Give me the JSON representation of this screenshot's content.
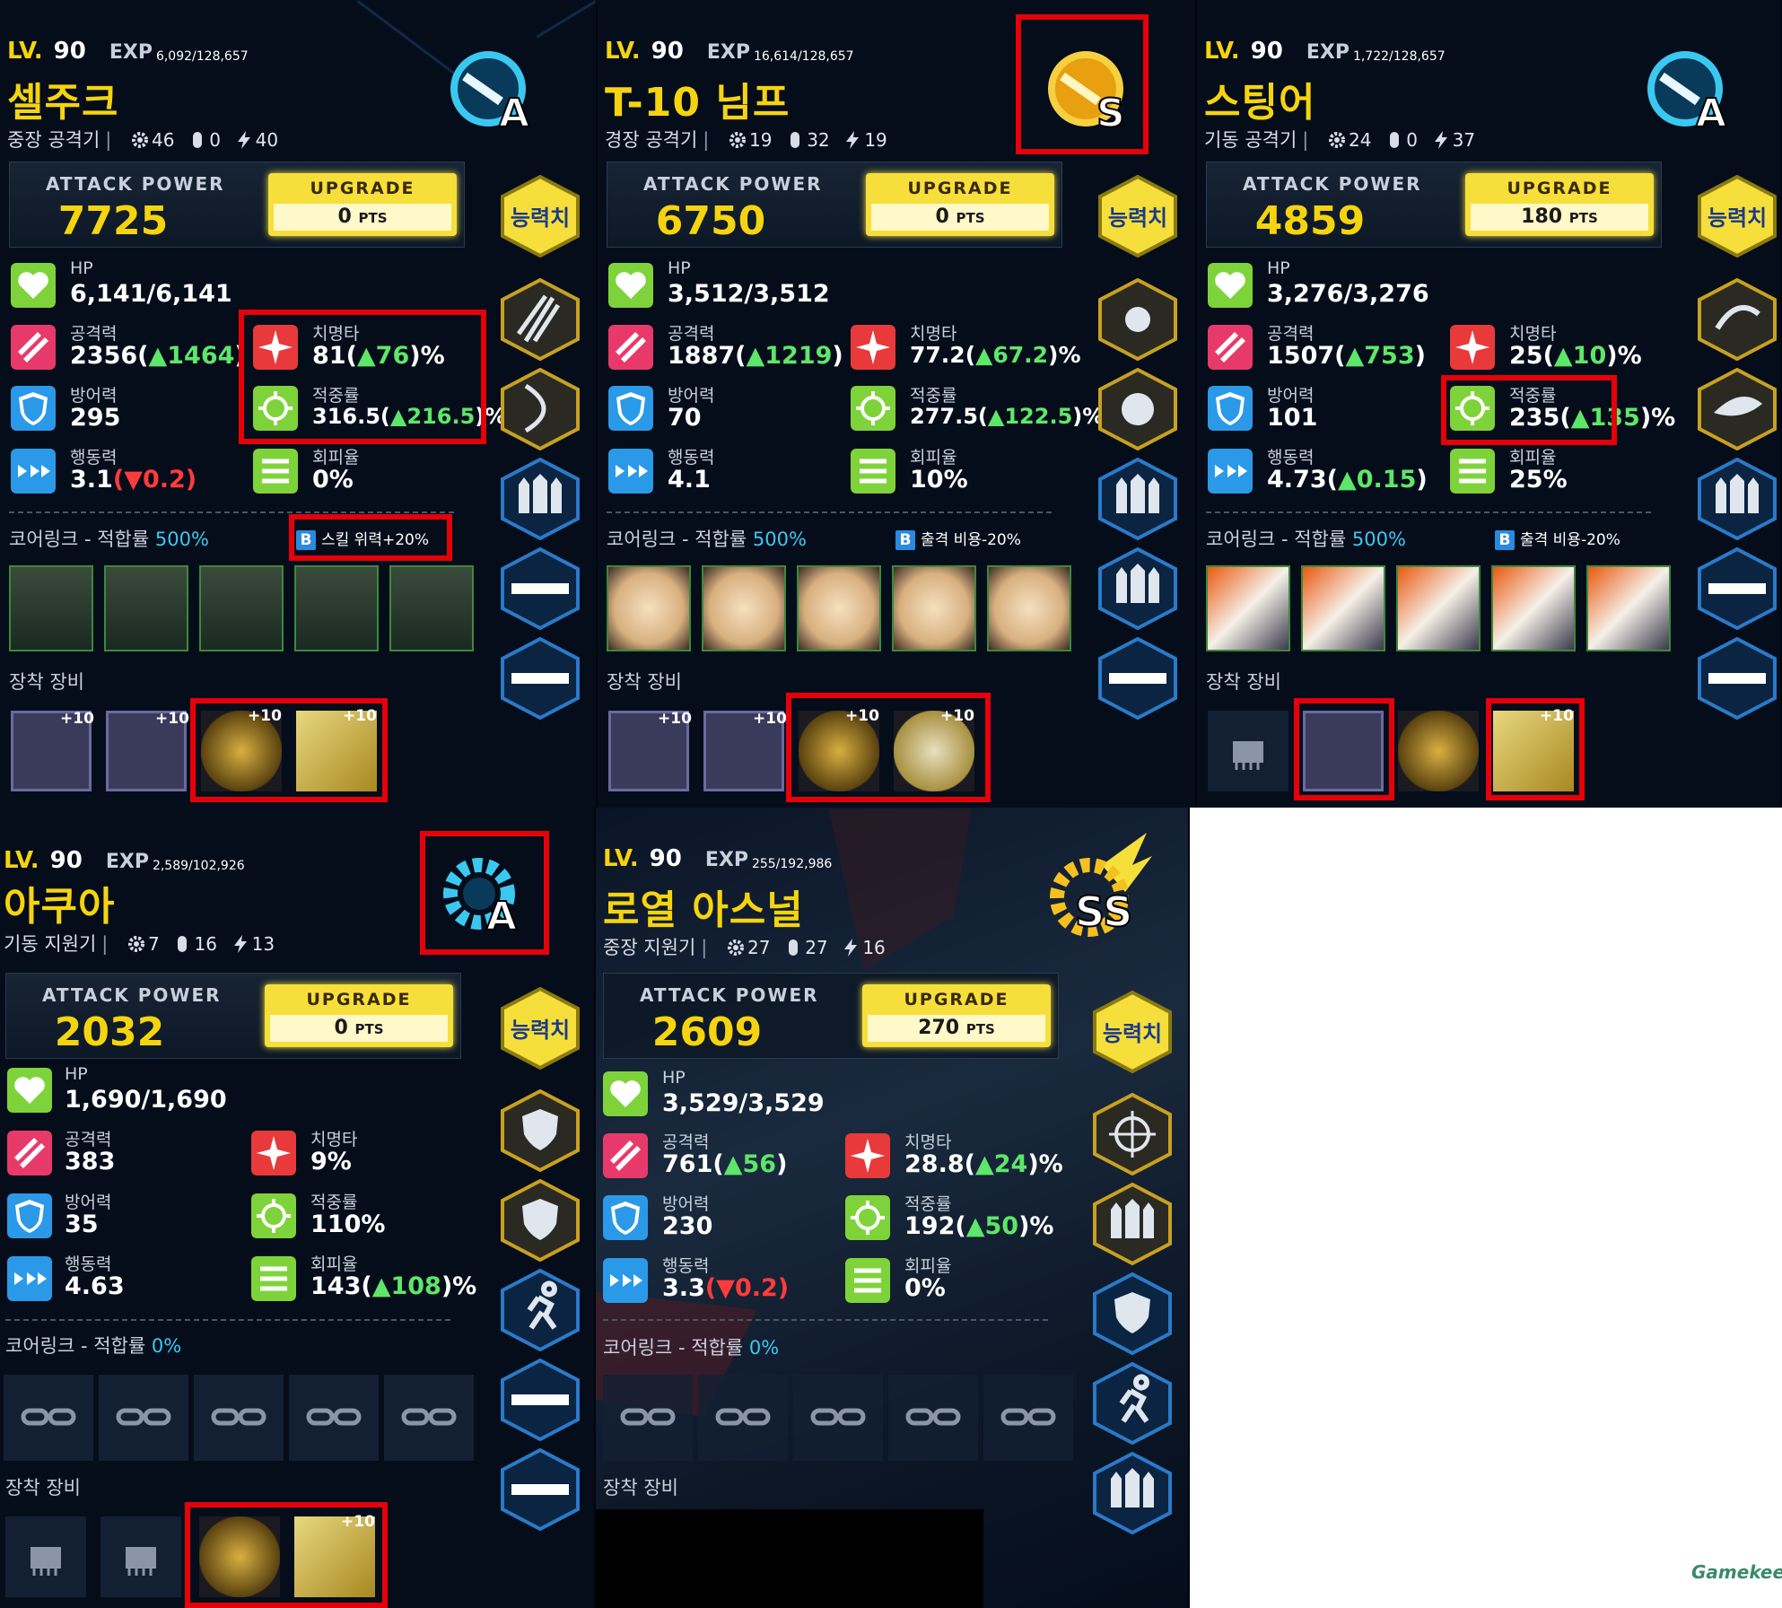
{
  "common": {
    "lv_label": "LV.",
    "exp_label": "EXP",
    "attack_power_label": "ATTACK POWER",
    "upgrade_label": "UPGRADE",
    "pts_suffix": "PTS",
    "stat_button_label": "능력치",
    "hp_label": "HP",
    "atk_label": "공격력",
    "def_label": "방어력",
    "spd_label": "행동력",
    "crit_label": "치명타",
    "acc_label": "적중률",
    "eva_label": "회피율",
    "core_link_label": "코어링크 - 적합률",
    "equip_label": "장착 장비",
    "equip_plus": "+10",
    "bonus_b": "B"
  },
  "panels": [
    {
      "level": "90",
      "exp": "6,092/128,657",
      "name": "셀주크",
      "class": "중장 공격기",
      "gear": "46",
      "slot": "0",
      "bolt": "40",
      "grade": "A",
      "attack_power": "7725",
      "upgrade_pts": "0",
      "hp": "6,141/6,141",
      "atk": "2356",
      "atk_up": "▲1464",
      "def": "295",
      "spd": "3.1",
      "spd_change": "▼0.2",
      "crit": "81",
      "crit_up": "▲76",
      "acc": "316.5",
      "acc_up": "▲216.5",
      "eva": "0%",
      "core_pct": "500%",
      "bonus": "스킬 위력+20%"
    },
    {
      "level": "90",
      "exp": "16,614/128,657",
      "name": "T-10 님프",
      "class": "경장 공격기",
      "gear": "19",
      "slot": "32",
      "bolt": "19",
      "grade": "S",
      "attack_power": "6750",
      "upgrade_pts": "0",
      "hp": "3,512/3,512",
      "atk": "1887",
      "atk_up": "▲1219",
      "def": "70",
      "spd": "4.1",
      "crit": "77.2",
      "crit_up": "▲67.2",
      "acc": "277.5",
      "acc_up": "▲122.5",
      "eva": "10%",
      "core_pct": "500%",
      "bonus": "출격 비용-20%"
    },
    {
      "level": "90",
      "exp": "1,722/128,657",
      "name": "스팅어",
      "class": "기동 공격기",
      "gear": "24",
      "slot": "0",
      "bolt": "37",
      "grade": "A",
      "attack_power": "4859",
      "upgrade_pts": "180",
      "hp": "3,276/3,276",
      "atk": "1507",
      "atk_up": "▲753",
      "def": "101",
      "spd": "4.73",
      "spd_up": "▲0.15",
      "crit": "25",
      "crit_up": "▲10",
      "acc": "235",
      "acc_up": "▲135",
      "eva": "25%",
      "core_pct": "500%",
      "bonus": "출격 비용-20%"
    },
    {
      "level": "90",
      "exp": "2,589/102,926",
      "name": "아쿠아",
      "class": "기동 지원기",
      "gear": "7",
      "slot": "16",
      "bolt": "13",
      "grade": "A",
      "attack_power": "2032",
      "upgrade_pts": "0",
      "hp": "1,690/1,690",
      "atk": "383",
      "def": "35",
      "spd": "4.63",
      "crit": "9%",
      "acc": "110%",
      "eva": "143",
      "eva_up": "▲108",
      "core_pct": "0%"
    },
    {
      "level": "90",
      "exp": "255/192,986",
      "name": "로열 아스널",
      "class": "중장 지원기",
      "gear": "27",
      "slot": "27",
      "bolt": "16",
      "grade": "SS",
      "attack_power": "2609",
      "upgrade_pts": "270",
      "hp": "3,529/3,529",
      "atk": "761",
      "atk_up": "▲56",
      "def": "230",
      "spd": "3.3",
      "spd_change": "▼0.2",
      "crit": "28.8",
      "crit_up": "▲24",
      "acc": "192",
      "acc_up": "▲50",
      "eva": "0%",
      "core_pct": "0%"
    }
  ],
  "watermark": "Gamekee",
  "colors": {
    "accent_yellow": "#f5d40f",
    "panel_bg": "#050d1b",
    "up_green": "#5ee66a",
    "down_red": "#ff3b3b",
    "highlight_red": "#e6000a",
    "core_blue": "#3ac8f0"
  }
}
